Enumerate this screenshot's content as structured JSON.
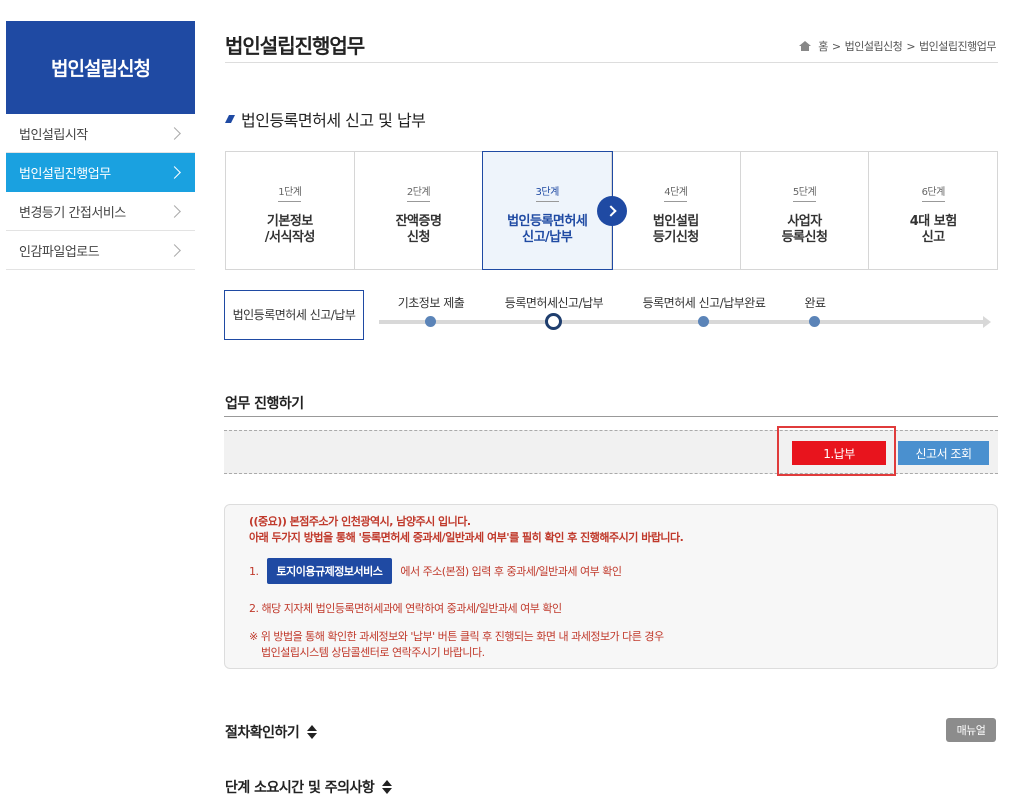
{
  "sidebar": {
    "title": "법인설립신청",
    "items": [
      {
        "label": "법인설립시작",
        "active": false
      },
      {
        "label": "법인설립진행업무",
        "active": true
      },
      {
        "label": "변경등기 간접서비스",
        "active": false
      },
      {
        "label": "인감파일업로드",
        "active": false
      }
    ]
  },
  "header": {
    "title": "법인설립진행업무",
    "breadcrumb": [
      "홈",
      "법인설립신청",
      "법인설립진행업무"
    ]
  },
  "section": {
    "title": "법인등록면허세 신고 및 납부"
  },
  "steps": [
    {
      "num": "1단계",
      "label": "기본정보\n/서식작성"
    },
    {
      "num": "2단계",
      "label": "잔액증명\n신청"
    },
    {
      "num": "3단계",
      "label": "법인등록면허세\n신고/납부",
      "active": true
    },
    {
      "num": "4단계",
      "label": "법인설립\n등기신청"
    },
    {
      "num": "5단계",
      "label": "사업자\n등록신청"
    },
    {
      "num": "6단계",
      "label": "4대 보험\n신고"
    }
  ],
  "progress": {
    "current_box": "법인등록면허세 신고/납부",
    "points": [
      "기초정보 제출",
      "등록면허세신고/납부",
      "등록면허세 신고/납부완료",
      "완료"
    ],
    "current_index": 1
  },
  "task": {
    "title": "업무 진행하기",
    "pay_button": "1.납부",
    "view_button": "신고서 조회"
  },
  "notice": {
    "line1": "((중요)) 본점주소가 인천광역시, 남양주시 입니다.",
    "line2": "아래 두가지 방법을 통해 '등록면허세 중과세/일반과세 여부'를 필히 확인 후 진행해주시기 바랍니다.",
    "item1_num": "1.",
    "item1_button": "토지이용규제정보서비스",
    "item1_text": "에서 주소(본점) 입력 후 중과세/일반과세 여부 확인",
    "item2": "2.  해당 지자체 법인등록면허세과에 연락하여 중과세/일반과세 여부 확인",
    "note": "※ 위 방법을 통해 확인한 과세정보와 '납부' 버튼 클릭 후 진행되는 화면 내 과세정보가 다른 경우\n    법인설립시스템 상담콜센터로 연락주시기 바랍니다."
  },
  "bottom": {
    "procedure_title": "절차확인하기",
    "manual_button": "매뉴얼",
    "time_title": "단계 소요시간 및 주의사항"
  },
  "colors": {
    "primary": "#1f4aa3",
    "active_menu": "#1aa1e0",
    "pay_red": "#e8141d",
    "view_blue": "#4a90cf"
  }
}
